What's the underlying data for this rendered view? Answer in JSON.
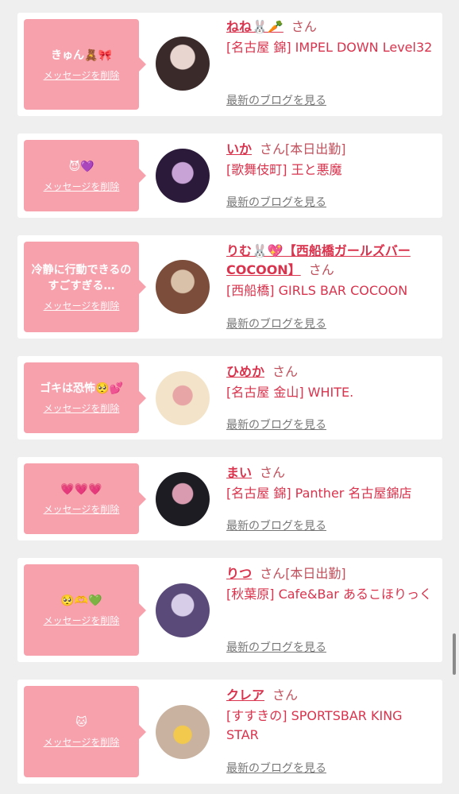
{
  "cards": [
    {
      "message": "きゅん🧸🎀",
      "delete_label": "メッセージを削除",
      "name": "ねね🐰🥕",
      "suffix": "さん",
      "status": "",
      "shop": "[名古屋 錦] IMPEL DOWN Level32",
      "blog_label": "最新のブログを見る",
      "avatar_colors": [
        "#3a2a2a",
        "#e8d5cf"
      ]
    },
    {
      "message": "😈💜",
      "delete_label": "メッセージを削除",
      "name": "いか",
      "suffix": "さん",
      "status": "[本日出勤]",
      "shop": "[歌舞伎町] 王と悪魔",
      "blog_label": "最新のブログを見る",
      "avatar_colors": [
        "#2b1a3a",
        "#c7a3d6"
      ]
    },
    {
      "message": "冷静に行動できるのすごすぎる…",
      "delete_label": "メッセージを削除",
      "name": "りむ🐰💖【西船橋ガールズバーCOCOON】",
      "suffix": "さん",
      "status": "",
      "shop": "[西船橋] GIRLS BAR COCOON",
      "blog_label": "最新のブログを見る",
      "avatar_colors": [
        "#d9c0a8",
        "#7b4d3a"
      ]
    },
    {
      "message": "ゴキは恐怖🥺💕",
      "delete_label": "メッセージを削除",
      "name": "ひめか",
      "suffix": "さん",
      "status": "",
      "shop": "[名古屋 金山] WHITE.",
      "blog_label": "最新のブログを見る",
      "avatar_colors": [
        "#f3e4c9",
        "#e8a5a5"
      ]
    },
    {
      "message": "💗💗💗",
      "delete_label": "メッセージを削除",
      "name": "まい",
      "suffix": "さん",
      "status": "",
      "shop": "[名古屋 錦] Panther 名古屋錦店",
      "blog_label": "最新のブログを見る",
      "avatar_colors": [
        "#1c1c22",
        "#d99bb0"
      ]
    },
    {
      "message": "🥺🫶💚",
      "delete_label": "メッセージを削除",
      "name": "りつ",
      "suffix": "さん",
      "status": "[本日出勤]",
      "shop": "[秋葉原] Cafe&Bar あるこほりっく",
      "blog_label": "最新のブログを見る",
      "avatar_colors": [
        "#5a4a7a",
        "#d7cde8"
      ]
    },
    {
      "message": "🐱",
      "delete_label": "メッセージを削除",
      "name": "クレア",
      "suffix": "さん",
      "status": "",
      "shop": "[すすきの] SPORTSBAR KING STAR",
      "blog_label": "最新のブログを見る",
      "avatar_colors": [
        "#c9b3a0",
        "#f2c94c"
      ]
    }
  ]
}
